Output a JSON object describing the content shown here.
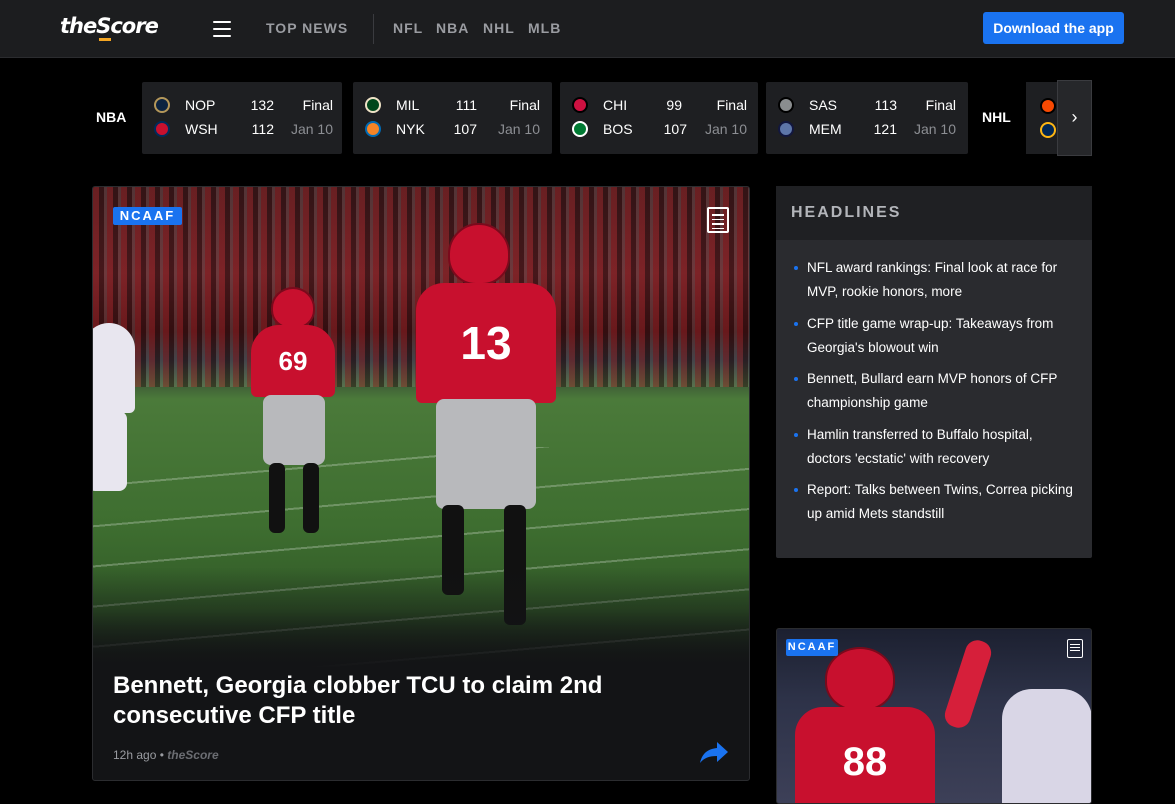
{
  "nav": {
    "logo": "theScore",
    "links": [
      "TOP NEWS",
      "NFL",
      "NBA",
      "NHL",
      "MLB"
    ],
    "download": "Download the app"
  },
  "scores": {
    "leagues": [
      "NBA",
      "NHL"
    ],
    "games": [
      {
        "away": {
          "abbr": "NOP",
          "score": "132",
          "color": "#0c2340"
        },
        "home": {
          "abbr": "WSH",
          "score": "112",
          "color": "#c8102e"
        },
        "status": "Final",
        "date": "Jan 10"
      },
      {
        "away": {
          "abbr": "MIL",
          "score": "111",
          "color": "#00471b"
        },
        "home": {
          "abbr": "NYK",
          "score": "107",
          "color": "#f58426"
        },
        "status": "Final",
        "date": "Jan 10"
      },
      {
        "away": {
          "abbr": "CHI",
          "score": "99",
          "color": "#ce1141"
        },
        "home": {
          "abbr": "BOS",
          "score": "107",
          "color": "#007a33"
        },
        "status": "Final",
        "date": "Jan 10"
      },
      {
        "away": {
          "abbr": "SAS",
          "score": "113",
          "color": "#8a8d8f"
        },
        "home": {
          "abbr": "MEM",
          "score": "121",
          "color": "#5d76a9"
        },
        "status": "Final",
        "date": "Jan 10"
      }
    ]
  },
  "main_story": {
    "badge": "NCAAF",
    "title": "Bennett, Georgia clobber TCU to claim 2nd consecutive CFP title",
    "time": "12h ago",
    "separator": "•",
    "source": "theScore",
    "jersey_primary": "13",
    "jersey_secondary": "69"
  },
  "headlines": {
    "title": "HEADLINES",
    "items": [
      "NFL award rankings: Final look at race for MVP, rookie honors, more",
      "CFP title game wrap-up: Takeaways from Georgia's blowout win",
      "Bennett, Bullard earn MVP honors of CFP championship game",
      "Hamlin transferred to Buffalo hospital, doctors 'ecstatic' with recovery",
      "Report: Talks between Twins, Correa picking up amid Mets standstill"
    ]
  },
  "second_story": {
    "badge": "NCAAF",
    "jersey": "88"
  },
  "colors": {
    "accent": "#1a73f0",
    "georgia_red": "#c8102e",
    "logo_underline": "#f5a623"
  }
}
